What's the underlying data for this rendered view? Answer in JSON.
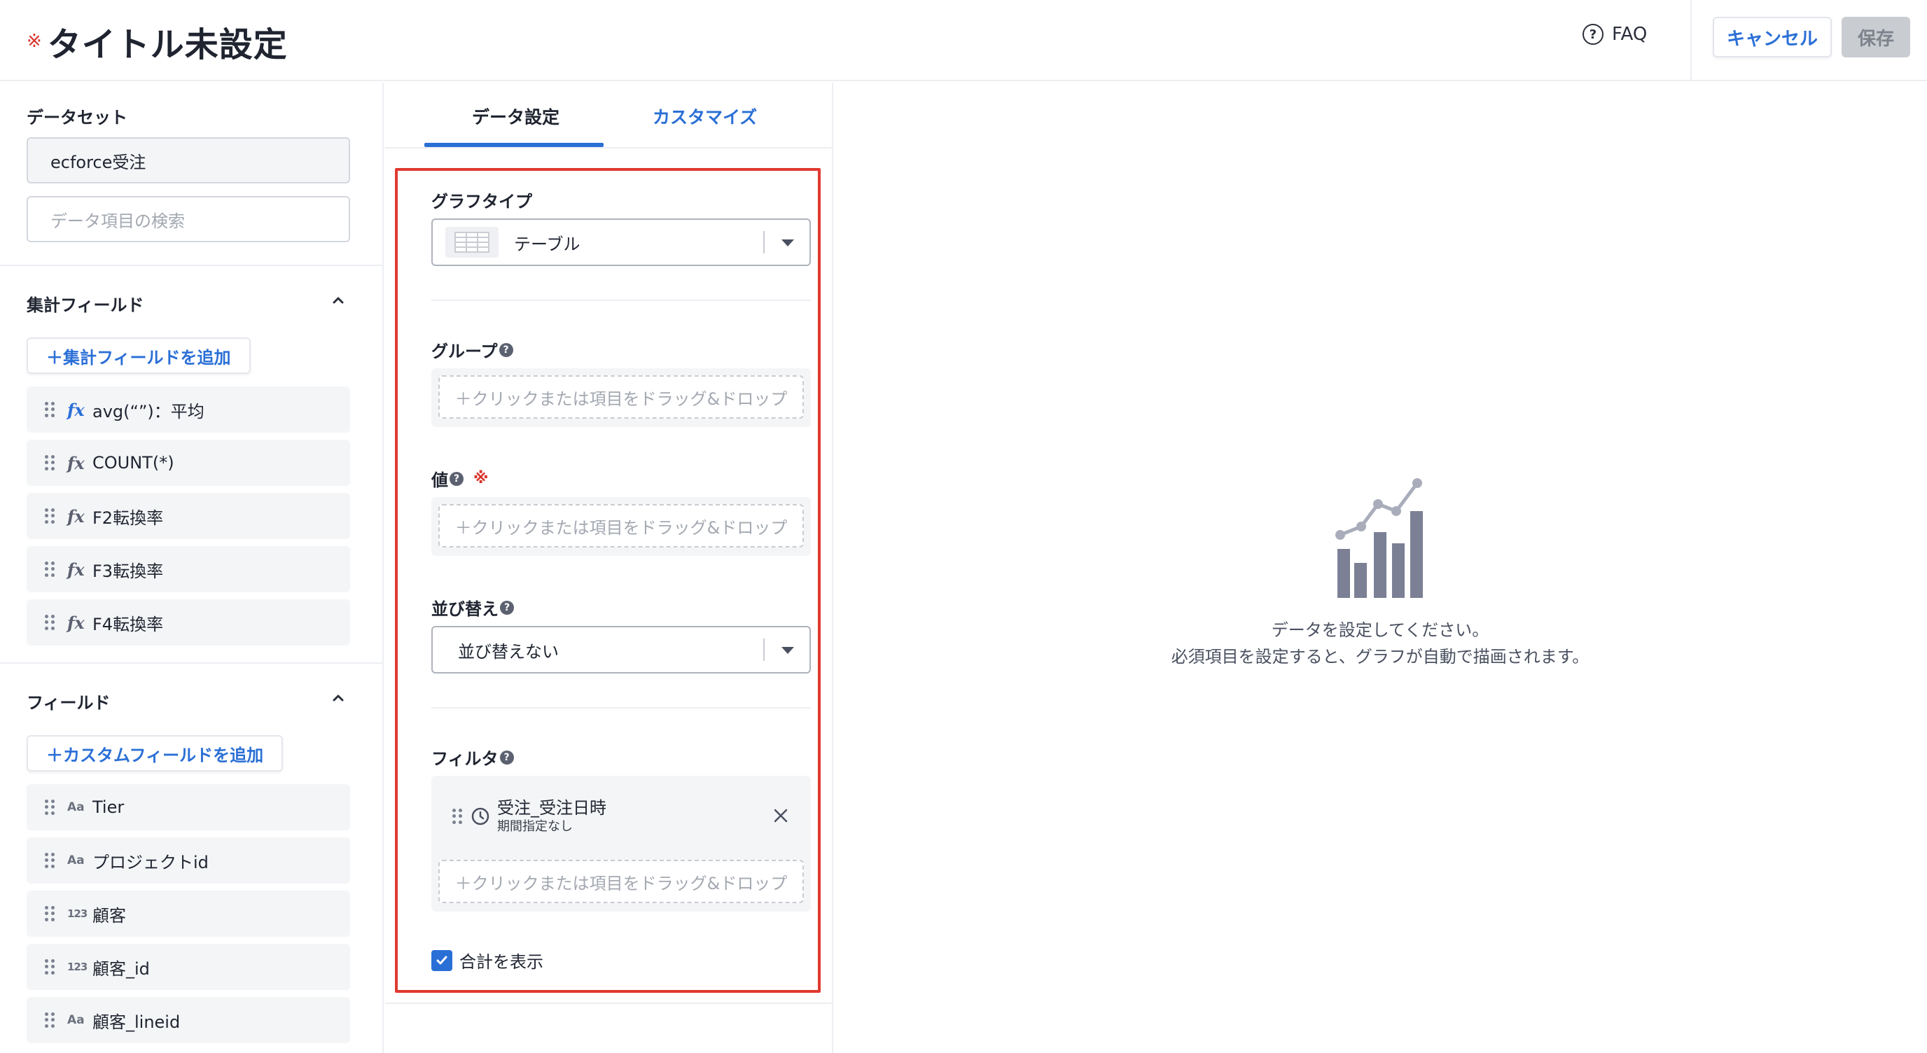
{
  "header": {
    "required_mark": "※",
    "title": "タイトル未設定",
    "faq_label": "FAQ",
    "cancel_label": "キャンセル",
    "save_label": "保存"
  },
  "left": {
    "dataset_label": "データセット",
    "dataset_value": "ecforce受注",
    "search_placeholder": "データ項目の検索",
    "aggregate_section": {
      "title": "集計フィールド",
      "add_label": "＋集計フィールドを追加",
      "items": [
        {
          "type": "fx",
          "label": "avg(“”)：平均",
          "highlight": true
        },
        {
          "type": "fx",
          "label": "COUNT(*)"
        },
        {
          "type": "fx",
          "label": "F2転換率"
        },
        {
          "type": "fx",
          "label": "F3転換率"
        },
        {
          "type": "fx",
          "label": "F4転換率"
        }
      ]
    },
    "field_section": {
      "title": "フィールド",
      "add_label": "＋カスタムフィールドを追加",
      "items": [
        {
          "type": "Aa",
          "label": "Tier"
        },
        {
          "type": "Aa",
          "label": "プロジェクトid"
        },
        {
          "type": "123",
          "label": "顧客"
        },
        {
          "type": "123",
          "label": "顧客_id"
        },
        {
          "type": "Aa",
          "label": "顧客_lineid"
        }
      ]
    }
  },
  "middle": {
    "tabs": [
      {
        "label": "データ設定",
        "active": true
      },
      {
        "label": "カスタマイズ",
        "active": false
      }
    ],
    "graph_type_label": "グラフタイプ",
    "graph_type_value": "テーブル",
    "group_label": "グループ",
    "value_label": "値",
    "value_required_mark": "※",
    "sort_label": "並び替え",
    "sort_value": "並び替えない",
    "filter_label": "フィルタ",
    "help_glyph": "?",
    "dropzone_text": "＋クリックまたは項目をドラッグ&ドロップ",
    "filter_chip": {
      "title": "受注_受注日時",
      "subtitle": "期間指定なし"
    },
    "show_total_label": "合計を表示",
    "show_total_checked": true
  },
  "empty_state": {
    "line1": "データを設定してください。",
    "line2": "必須項目を設定すると、グラフが自動で描画されます。",
    "icon": "bar-line-chart-icon"
  },
  "colors": {
    "accent": "#2a6fd6",
    "required": "#d9342b",
    "highlight_border": "#e0392f",
    "chart_icon": "#7b8095"
  }
}
